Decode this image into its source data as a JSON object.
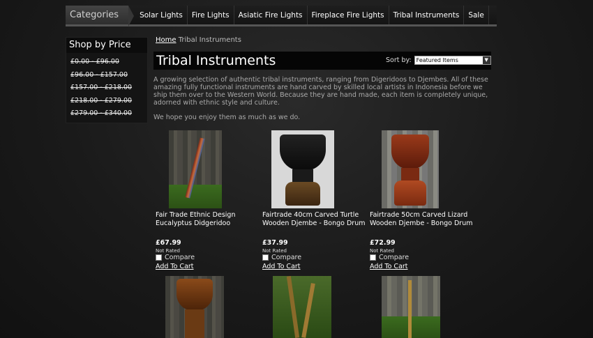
{
  "nav": {
    "categories_label": "Categories",
    "items": [
      "Solar Lights",
      "Fire Lights",
      "Asiatic Fire Lights",
      "Fireplace Fire Lights",
      "Tribal Instruments",
      "Sale"
    ]
  },
  "sidebar": {
    "title": "Shop by Price",
    "ranges": [
      "£0.00 - £96.00",
      "£96.00 - £157.00",
      "£157.00 - £218.00",
      "£218.00 - £279.00",
      "£279.00 - £340.00"
    ]
  },
  "breadcrumb": {
    "home": "Home",
    "current": "Tribal Instruments"
  },
  "page": {
    "title": "Tribal Instruments",
    "sort_label": "Sort by:",
    "sort_value": "Featured Items",
    "description": "A growing selection of authentic tribal instruments, ranging from Digeridoos to Djembes. All of these amazing fully functional instruments are hand carved by skilled local artists in Indonesia before we ship them over to the Western World. Because they are hand made, each item is completely unique, adorned with ethnic style and culture.",
    "description2": "We hope you enjoy them as much as we do."
  },
  "products": [
    {
      "name": "Fair Trade Ethnic Design Eucalyptus Didgeridoo",
      "price": "£67.99",
      "rating": "Not Rated",
      "compare": "Compare",
      "cart": "Add To Cart"
    },
    {
      "name": "Fairtrade 40cm Carved Turtle Wooden Djembe - Bongo Drum",
      "price": "£37.99",
      "rating": "Not Rated",
      "compare": "Compare",
      "cart": "Add To Cart"
    },
    {
      "name": "Fairtrade 50cm Carved Lizard Wooden Djembe - Bongo Drum",
      "price": "£72.99",
      "rating": "Not Rated",
      "compare": "Compare",
      "cart": "Add To Cart"
    }
  ]
}
